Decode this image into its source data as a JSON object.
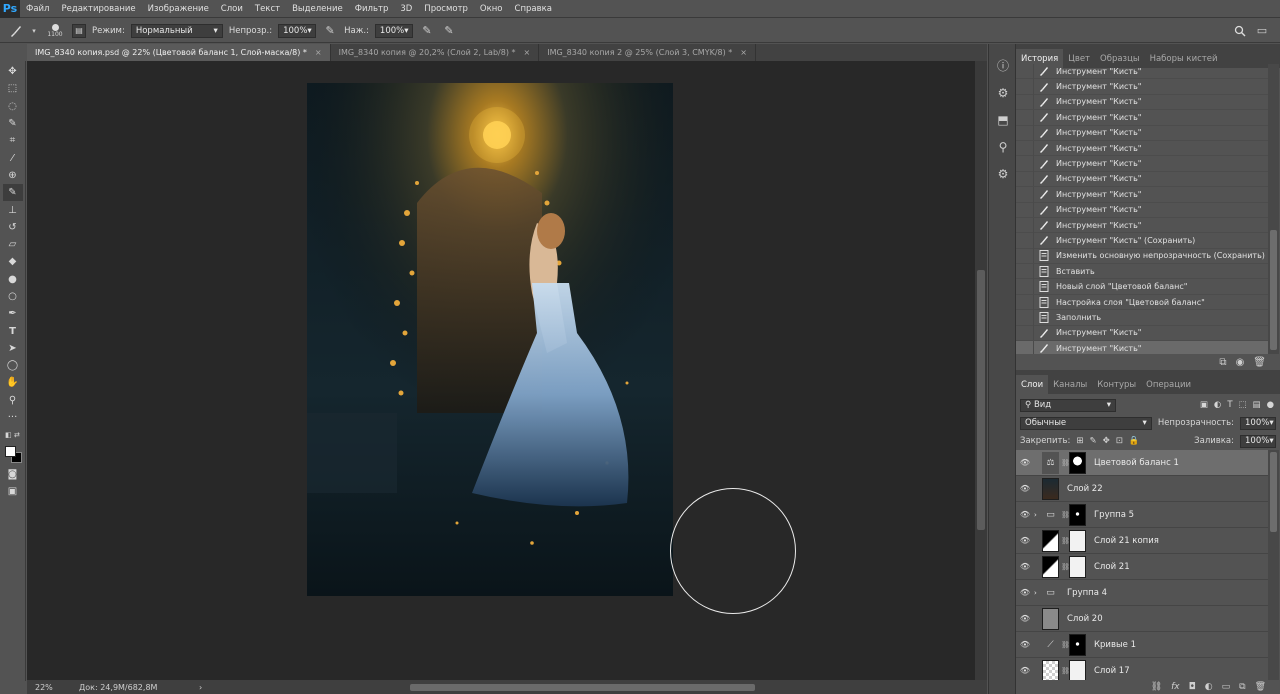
{
  "app": {
    "logo": "Ps"
  },
  "menu": [
    "Файл",
    "Редактирование",
    "Изображение",
    "Слои",
    "Текст",
    "Выделение",
    "Фильтр",
    "3D",
    "Просмотр",
    "Окно",
    "Справка"
  ],
  "options": {
    "brush_size": "1100",
    "mode_label": "Режим:",
    "mode_value": "Нормальный",
    "opacity_label": "Непрозр.:",
    "opacity_value": "100%",
    "pressure_label": "Наж.:",
    "pressure_value": "100%"
  },
  "tabs": [
    {
      "label": "IMG_8340 копия.psd @ 22% (Цветовой баланс 1, Слой-маска/8) *",
      "close": "×"
    },
    {
      "label": "IMG_8340 копия @ 20,2% (Слой 2, Lab/8) *",
      "close": "×"
    },
    {
      "label": "IMG_8340 копия 2 @ 25% (Слой 3, CMYK/8) *",
      "close": "×"
    }
  ],
  "status": {
    "zoom": "22%",
    "doc": "Док: 24,9M/682,8M",
    "arrow": "›"
  },
  "history": {
    "tabs": [
      "История",
      "Цвет",
      "Образцы",
      "Наборы кистей"
    ],
    "items": [
      {
        "label": "Инструмент \"Кисть\"",
        "icon": "brush-icon"
      },
      {
        "label": "Инструмент \"Кисть\"",
        "icon": "brush-icon"
      },
      {
        "label": "Инструмент \"Кисть\"",
        "icon": "brush-icon"
      },
      {
        "label": "Инструмент \"Кисть\"",
        "icon": "brush-icon"
      },
      {
        "label": "Инструмент \"Кисть\"",
        "icon": "brush-icon"
      },
      {
        "label": "Инструмент \"Кисть\"",
        "icon": "brush-icon"
      },
      {
        "label": "Инструмент \"Кисть\"",
        "icon": "brush-icon"
      },
      {
        "label": "Инструмент \"Кисть\"",
        "icon": "brush-icon"
      },
      {
        "label": "Инструмент \"Кисть\"",
        "icon": "brush-icon"
      },
      {
        "label": "Инструмент \"Кисть\"",
        "icon": "brush-icon"
      },
      {
        "label": "Инструмент \"Кисть\"",
        "icon": "brush-icon"
      },
      {
        "label": "Инструмент \"Кисть\" (Сохранить)",
        "icon": "brush-icon"
      },
      {
        "label": "Изменить основную непрозрачность (Сохранить)",
        "icon": "document-icon"
      },
      {
        "label": "Вставить",
        "icon": "document-icon"
      },
      {
        "label": "Новый слой \"Цветовой баланс\"",
        "icon": "document-icon"
      },
      {
        "label": "Настройка слоя \"Цветовой баланс\"",
        "icon": "document-icon"
      },
      {
        "label": "Заполнить",
        "icon": "document-icon"
      },
      {
        "label": "Инструмент \"Кисть\"",
        "icon": "brush-icon"
      },
      {
        "label": "Инструмент \"Кисть\"",
        "icon": "brush-icon"
      }
    ]
  },
  "layers": {
    "tabs": [
      "Слои",
      "Каналы",
      "Контуры",
      "Операции"
    ],
    "filter_label": "Вид",
    "blend_mode": "Обычные",
    "opacity_label": "Непрозрачность:",
    "opacity_value": "100%",
    "lock_label": "Закрепить:",
    "fill_label": "Заливка:",
    "fill_value": "100%",
    "items": [
      {
        "name": "Цветовой баланс 1",
        "thumb": "adjust",
        "mask": "black-white",
        "active": true
      },
      {
        "name": "Слой 22",
        "thumb": "photo",
        "mask": "",
        "active": false
      },
      {
        "name": "Группа 5",
        "thumb": "folder",
        "mask": "black",
        "active": false
      },
      {
        "name": "Слой 21 копия",
        "thumb": "photo-bw",
        "mask": "white",
        "active": false
      },
      {
        "name": "Слой 21",
        "thumb": "photo-bw",
        "mask": "white",
        "active": false
      },
      {
        "name": "Группа 4",
        "thumb": "folder",
        "mask": "",
        "active": false
      },
      {
        "name": "Слой 20",
        "thumb": "gray",
        "mask": "",
        "active": false
      },
      {
        "name": "Кривые 1",
        "thumb": "curves",
        "mask": "black",
        "active": false
      },
      {
        "name": "Слой 17",
        "thumb": "checker",
        "mask": "white",
        "active": false
      }
    ]
  },
  "colors": {
    "accent": "#31a8ff",
    "canvas_bg": "#282828",
    "ui_bg": "#535353"
  }
}
